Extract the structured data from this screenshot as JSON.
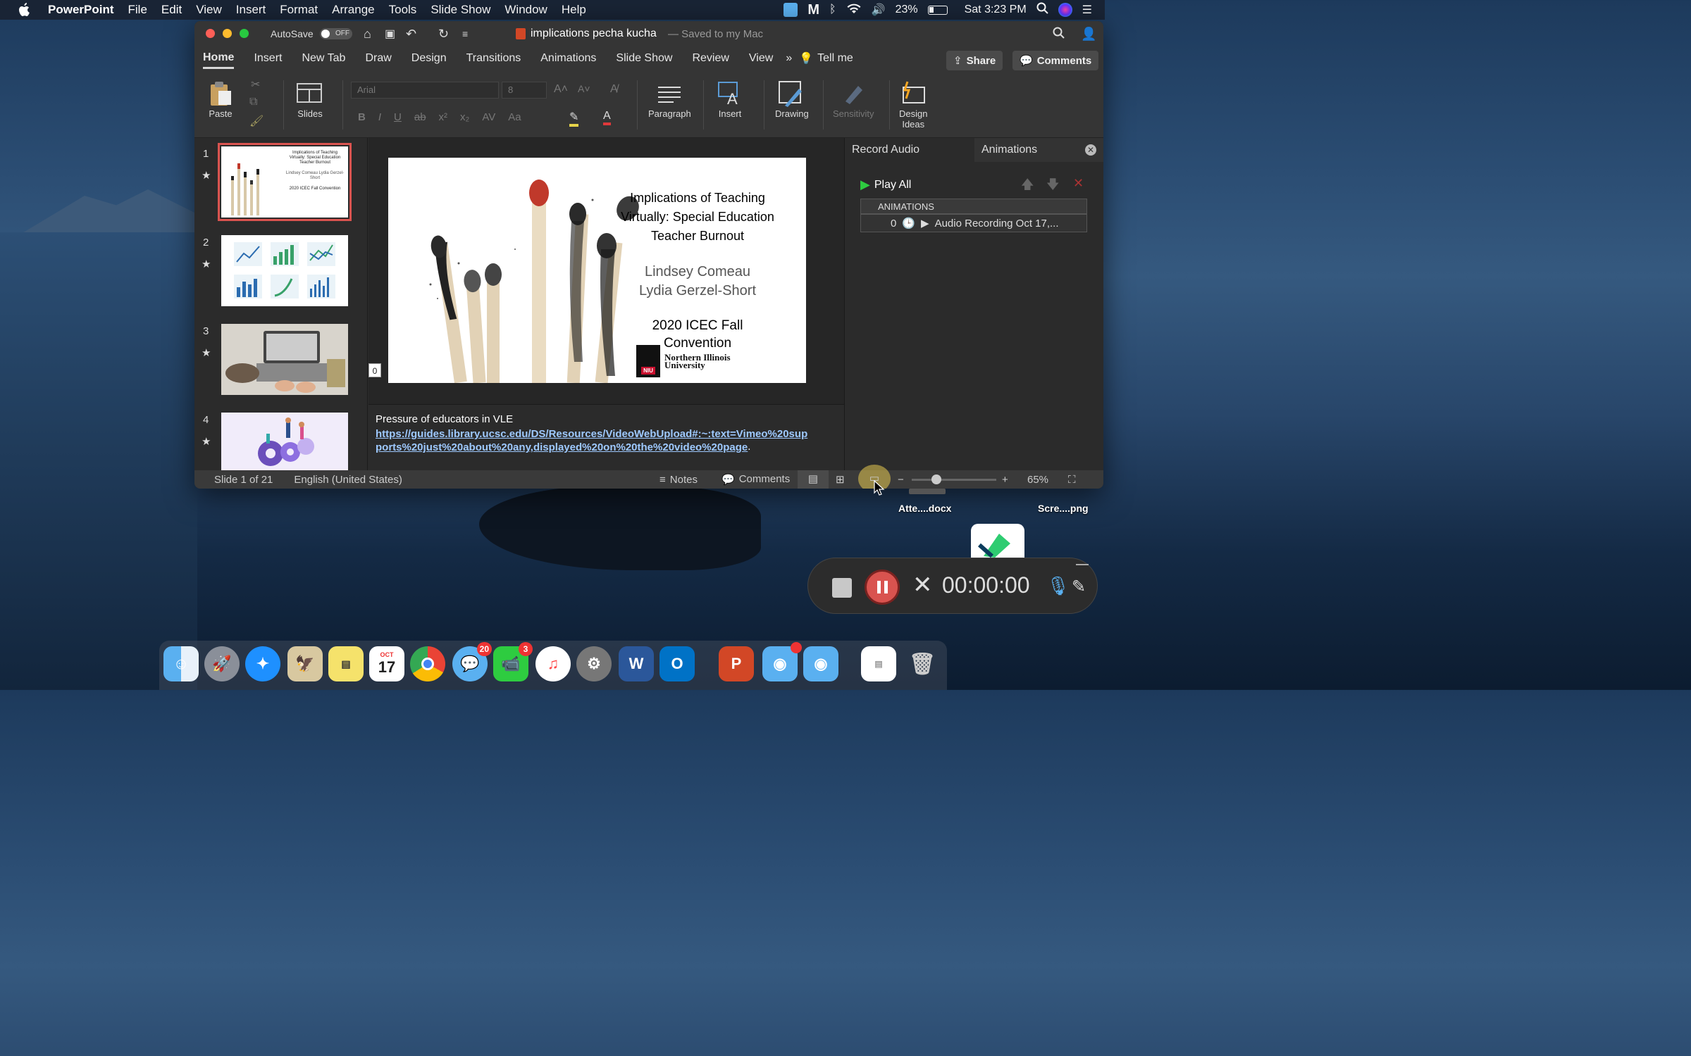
{
  "menubar": {
    "app_name": "PowerPoint",
    "items": [
      "File",
      "Edit",
      "View",
      "Insert",
      "Format",
      "Arrange",
      "Tools",
      "Slide Show",
      "Window",
      "Help"
    ],
    "battery": "23%",
    "clock": "Sat 3:23 PM"
  },
  "titlebar": {
    "autosave_label": "AutoSave",
    "autosave_state": "OFF",
    "doc_title": "implications pecha kucha",
    "save_status": "— Saved to my Mac"
  },
  "ribbon_tabs": [
    "Home",
    "Insert",
    "New Tab",
    "Draw",
    "Design",
    "Transitions",
    "Animations",
    "Slide Show",
    "Review",
    "View"
  ],
  "tell_me": "Tell me",
  "share_label": "Share",
  "comments_label": "Comments",
  "ribbon": {
    "paste": "Paste",
    "slides": "Slides",
    "font_name": "Arial",
    "font_size": "8",
    "paragraph": "Paragraph",
    "insert": "Insert",
    "drawing": "Drawing",
    "sensitivity": "Sensitivity",
    "design_ideas_1": "Design",
    "design_ideas_2": "Ideas"
  },
  "thumbnails": [
    {
      "num": "1",
      "title": "Implications of Teaching Virtually: Special Education Teacher Burnout",
      "authors": "Lindsey Comeau Lydia Gerzel-Short",
      "event": "2020 ICEC Fall Convention"
    },
    {
      "num": "2"
    },
    {
      "num": "3"
    },
    {
      "num": "4"
    }
  ],
  "slide": {
    "title_line1": "Implications of Teaching",
    "title_line2": "Virtually: Special Education",
    "title_line3": "Teacher Burnout",
    "author1": "Lindsey Comeau",
    "author2": "Lydia Gerzel-Short",
    "event_line1": "2020 ICEC Fall",
    "event_line2": "Convention",
    "logo_text1": "Northern Illinois",
    "logo_text2": "University",
    "logo_mark": "NIU",
    "marker": "0"
  },
  "notes": {
    "text": "Pressure of educators in VLE",
    "link_line1": "https://guides.library.ucsc.edu/DS/Resources/VideoWebUpload#:~:text=Vimeo%20sup",
    "link_line2": "ports%20just%20about%20any,displayed%20on%20the%20video%20page",
    "link_end": "."
  },
  "pane": {
    "tab_record": "Record Audio",
    "tab_animations": "Animations",
    "play_all": "Play All",
    "list_header": "ANIMATIONS",
    "item_index": "0",
    "item_label": "Audio Recording Oct 17,..."
  },
  "statusbar": {
    "slide_info": "Slide 1 of 21",
    "language": "English (United States)",
    "notes": "Notes",
    "comments": "Comments",
    "zoom": "65%",
    "zoom_level_percent": 65
  },
  "desktop": {
    "file1": "Atte....docx",
    "file2": "Scre....png"
  },
  "recorder": {
    "timer": "00:00:00"
  },
  "dock": {
    "calendar_month": "OCT",
    "calendar_day": "17",
    "messages_badge": "20",
    "facetime_badge": "3"
  },
  "colors": {
    "accent_red": "#d9534f",
    "play_green": "#2ecc40",
    "link_blue": "#9ec9ff"
  }
}
